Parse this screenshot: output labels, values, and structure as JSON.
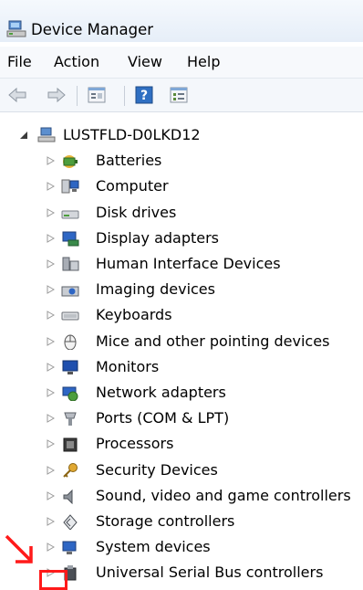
{
  "window": {
    "title": "Device Manager",
    "icon": "device-manager-icon"
  },
  "menu": {
    "items": [
      "File",
      "Action",
      "View",
      "Help"
    ]
  },
  "toolbar": {
    "buttons": [
      "back-arrow-icon",
      "forward-arrow-icon",
      "properties-icon",
      "help-icon",
      "show-hidden-icon"
    ]
  },
  "tree": {
    "root": {
      "label": "LUSTFLD-D0LKD12",
      "icon": "computer-icon",
      "expanded": true
    },
    "categories": [
      {
        "label": "Batteries",
        "icon": "battery-icon"
      },
      {
        "label": "Computer",
        "icon": "computer-monitor-icon"
      },
      {
        "label": "Disk drives",
        "icon": "disk-drive-icon"
      },
      {
        "label": "Display adapters",
        "icon": "display-adapter-icon"
      },
      {
        "label": "Human Interface Devices",
        "icon": "hid-icon"
      },
      {
        "label": "Imaging devices",
        "icon": "imaging-device-icon"
      },
      {
        "label": "Keyboards",
        "icon": "keyboard-icon"
      },
      {
        "label": "Mice and other pointing devices",
        "icon": "mouse-icon"
      },
      {
        "label": "Monitors",
        "icon": "monitor-icon"
      },
      {
        "label": "Network adapters",
        "icon": "network-adapter-icon"
      },
      {
        "label": "Ports (COM & LPT)",
        "icon": "port-icon"
      },
      {
        "label": "Processors",
        "icon": "processor-icon"
      },
      {
        "label": "Security Devices",
        "icon": "security-key-icon"
      },
      {
        "label": "Sound, video and game controllers",
        "icon": "speaker-icon"
      },
      {
        "label": "Storage controllers",
        "icon": "storage-controller-icon"
      },
      {
        "label": "System devices",
        "icon": "system-device-icon"
      },
      {
        "label": "Universal Serial Bus controllers",
        "icon": "usb-icon"
      }
    ]
  },
  "annotation": {
    "color": "#ff1a1a"
  }
}
